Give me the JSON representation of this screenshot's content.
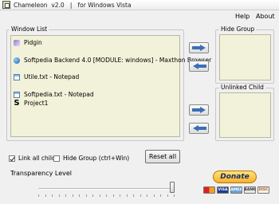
{
  "window": {
    "title": "Chameleon  v2.0   |   for Windows Vista"
  },
  "menu": {
    "help": "Help",
    "about": "About"
  },
  "window_list": {
    "legend": "Window List",
    "items": [
      {
        "label": "Pidgin",
        "icon": "pidgin-icon"
      },
      {
        "label": "Softpedia Backend 4.0 [MODULE: windows] - Maxthon Browser",
        "icon": "maxthon-icon"
      },
      {
        "label": "Utile.txt - Notepad",
        "icon": "notepad-icon"
      },
      {
        "label": "Softpedia.txt - Notepad",
        "icon": "notepad-icon"
      },
      {
        "label": "Project1",
        "icon": "s-icon"
      }
    ]
  },
  "hide_group": {
    "legend": "Hide Group"
  },
  "unlinked_child": {
    "legend": "Unlinked Child"
  },
  "options": {
    "link_all_child_label": "Link all child",
    "link_all_child_checked": true,
    "hide_group_label": "Hide Group (ctrl+Win)",
    "hide_group_checked": false,
    "reset_label": "Reset all"
  },
  "transparency": {
    "label": "Transparency Level",
    "level_fraction": 0.99
  },
  "donate": {
    "label": "Donate",
    "cards": [
      "MC",
      "VISA",
      "AMEX",
      "BANK",
      "DISC"
    ]
  },
  "colors": {
    "arrow": "#3b6fb6",
    "list_background": "#f2f2da",
    "donate_gold": "#f6b12c"
  }
}
